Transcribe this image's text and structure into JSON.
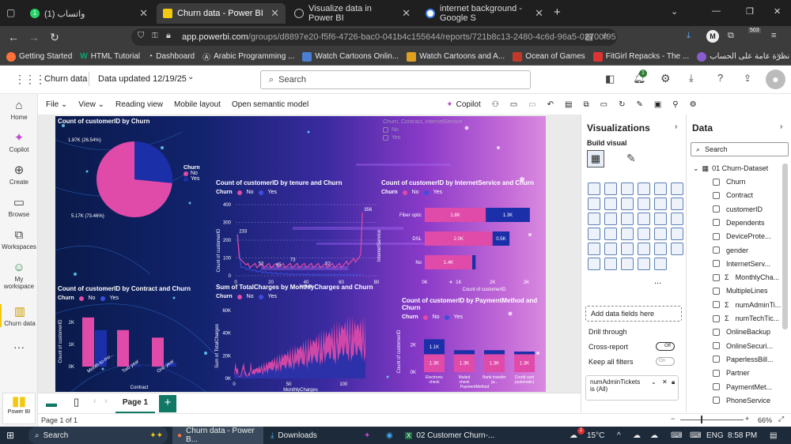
{
  "browser": {
    "tabs": [
      {
        "label": "واتساب (1)",
        "badge": "1"
      },
      {
        "label": "Churn data - Power BI"
      },
      {
        "label": "Visualize data in Power BI"
      },
      {
        "label": "internet background - Google S"
      }
    ],
    "url_host": "app.powerbi.com",
    "url_path": "/groups/d8897e20-f5f6-4726-bac0-041b4c155644/reports/721b8c13-2480-4c6d-96a5-02700f95",
    "profile_initial": "M",
    "ext_badge": "503"
  },
  "bookmarks": [
    {
      "label": "Getting Started"
    },
    {
      "label": "HTML Tutorial"
    },
    {
      "label": "Dashboard"
    },
    {
      "label": "Arabic Programming ..."
    },
    {
      "label": "Watch Cartoons Onlin..."
    },
    {
      "label": "Watch Cartoons and A..."
    },
    {
      "label": "Ocean of Games"
    },
    {
      "label": "FitGirl Repacks - The ..."
    },
    {
      "label": "نظرة عامة على الحساب"
    }
  ],
  "pbi": {
    "report_name": "Churn data",
    "updated": "Data updated 12/19/25",
    "search_placeholder": "Search",
    "notif_count": "1"
  },
  "rail": [
    {
      "label": "Home"
    },
    {
      "label": "Copilot"
    },
    {
      "label": "Create"
    },
    {
      "label": "Browse"
    },
    {
      "label": "Workspaces"
    },
    {
      "label": "My workspace"
    },
    {
      "label": "Churn data"
    }
  ],
  "ribbon": {
    "file": "File",
    "view": "View",
    "reading": "Reading view",
    "mobile": "Mobile layout",
    "open_model": "Open semantic model",
    "copilot": "Copilot"
  },
  "report": {
    "slicer_title": "Churn, Contract, InternetService",
    "slicer_items": [
      "No",
      "Yes"
    ],
    "colors": {
      "no": "#e04aa8",
      "yes": "#1b2fa8"
    },
    "legend_title": "Churn",
    "legend_no": "No",
    "legend_yes": "Yes"
  },
  "chart_data": [
    {
      "type": "pie",
      "title": "Count of customerID by Churn",
      "categories": [
        "No",
        "Yes"
      ],
      "values": [
        5170,
        1870
      ],
      "labels": [
        "5.17K (73.46%)",
        "1.87K (26.54%)"
      ]
    },
    {
      "type": "line",
      "title": "Count of customerID by tenure and Churn",
      "xlabel": "tenure",
      "ylabel": "Count of customerID",
      "ylim": [
        0,
        400
      ],
      "yticks": [
        "0",
        "100",
        "200",
        "300",
        "400"
      ],
      "xticks": [
        "0",
        "20",
        "40",
        "60",
        "80"
      ],
      "annotations": [
        "233",
        "52",
        "45",
        "73",
        "52",
        "356"
      ]
    },
    {
      "type": "bar",
      "title": "Count of customerID by InternetService and Churn",
      "orientation": "horizontal",
      "categories": [
        "Fiber optic",
        "DSL",
        "No"
      ],
      "series": [
        {
          "name": "No",
          "values": [
            1.8,
            2.0,
            1.4
          ],
          "labels": [
            "1.8K",
            "2.0K",
            "1.4K"
          ]
        },
        {
          "name": "Yes",
          "values": [
            1.3,
            0.5,
            0.1
          ],
          "labels": [
            "1.3K",
            "0.5K",
            ""
          ]
        }
      ],
      "xlabel": "Count of customerID",
      "ylabel": "InternetService",
      "xticks": [
        "0K",
        "1K",
        "2K",
        "3K"
      ]
    },
    {
      "type": "bar",
      "title": "Count of customerID by Contract and Churn",
      "categories": [
        "Month-to-mo...",
        "Two year",
        "One year"
      ],
      "series": [
        {
          "name": "No",
          "values": [
            2220,
            1650,
            1310
          ]
        },
        {
          "name": "Yes",
          "values": [
            1650,
            50,
            170
          ]
        }
      ],
      "xlabel": "Contract",
      "ylabel": "Count of customerID",
      "yticks": [
        "0K",
        "1K",
        "2K"
      ]
    },
    {
      "type": "area",
      "title": "Sum of TotalCharges by MonthlyCharges and Churn",
      "xlabel": "MonthlyCharges",
      "ylabel": "Sum of TotalCharges",
      "yticks": [
        "0K",
        "20K",
        "40K",
        "60K"
      ],
      "xticks": [
        "0",
        "50",
        "100"
      ]
    },
    {
      "type": "bar",
      "title": "Count of customerID by PaymentMethod and Churn",
      "categories": [
        "Electronic check",
        "Mailed check",
        "Bank transfer (a...",
        "Credit card (automatic)"
      ],
      "series": [
        {
          "name": "No",
          "values": [
            1.3,
            1.3,
            1.3,
            1.3
          ],
          "labels": [
            "1.3K",
            "1.3K",
            "1.3K",
            "1.3K"
          ]
        },
        {
          "name": "Yes",
          "values": [
            1.1,
            0.3,
            0.3,
            0.2
          ],
          "labels": [
            "1.1K",
            "",
            "",
            ""
          ]
        }
      ],
      "xlabel": "PaymentMethod",
      "ylabel": "Count of customerID",
      "yticks": [
        "0K",
        "2K"
      ]
    }
  ],
  "viz": {
    "title": "Visualizations",
    "build": "Build visual",
    "add_fields": "Add data fields here",
    "drill": "Drill through",
    "cross": "Cross-report",
    "off": "Off",
    "keep": "Keep all filters",
    "on": "On",
    "filter_field": "numAdminTickets",
    "filter_val": "is (All)",
    "more": "..."
  },
  "data": {
    "title": "Data",
    "search": "Search",
    "dataset": "01 Churn-Dataset",
    "fields": [
      "Churn",
      "Contract",
      "customerID",
      "Dependents",
      "DeviceProte...",
      "gender",
      "InternetServ...",
      "MonthlyCha...",
      "MultipleLines",
      "numAdminTi...",
      "numTechTic...",
      "OnlineBackup",
      "OnlineSecuri...",
      "PaperlessBill...",
      "Partner",
      "PaymentMet...",
      "PhoneService"
    ],
    "sigma": [
      false,
      false,
      false,
      false,
      false,
      false,
      false,
      true,
      false,
      true,
      true,
      false,
      false,
      false,
      false,
      false,
      false
    ]
  },
  "pages": {
    "page1": "Page 1",
    "count": "Page 1 of 1",
    "zoom": "66%",
    "brand": "Power BI"
  },
  "taskbar": {
    "search": "Search",
    "app1": "Churn data - Power B...",
    "app2": "Downloads",
    "app3": "02 Customer Churn-...",
    "weather": "15°C",
    "lang": "ENG",
    "time": "8:58 PM",
    "badge": "2"
  }
}
